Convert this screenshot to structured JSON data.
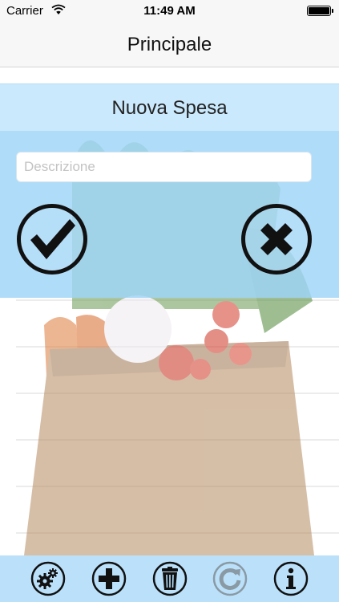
{
  "status_bar": {
    "carrier": "Carrier",
    "time": "11:49 AM"
  },
  "nav": {
    "title": "Principale"
  },
  "dialog": {
    "title": "Nuova Spesa",
    "description": {
      "value": "",
      "placeholder": "Descrizione"
    },
    "confirm_icon": "checkmark-icon",
    "cancel_icon": "close-x-icon"
  },
  "toolbar": {
    "items": [
      {
        "icon": "gears-icon",
        "enabled": true
      },
      {
        "icon": "plus-icon",
        "enabled": true
      },
      {
        "icon": "trash-icon",
        "enabled": true
      },
      {
        "icon": "refresh-icon",
        "enabled": false
      },
      {
        "icon": "info-icon",
        "enabled": true
      }
    ]
  },
  "colors": {
    "dialog_header": "#c8e8fc",
    "dialog_body": "#9ed4f8",
    "toolbar": "#b5defa",
    "icon": "#111111",
    "icon_disabled": "#8a9aa4"
  }
}
